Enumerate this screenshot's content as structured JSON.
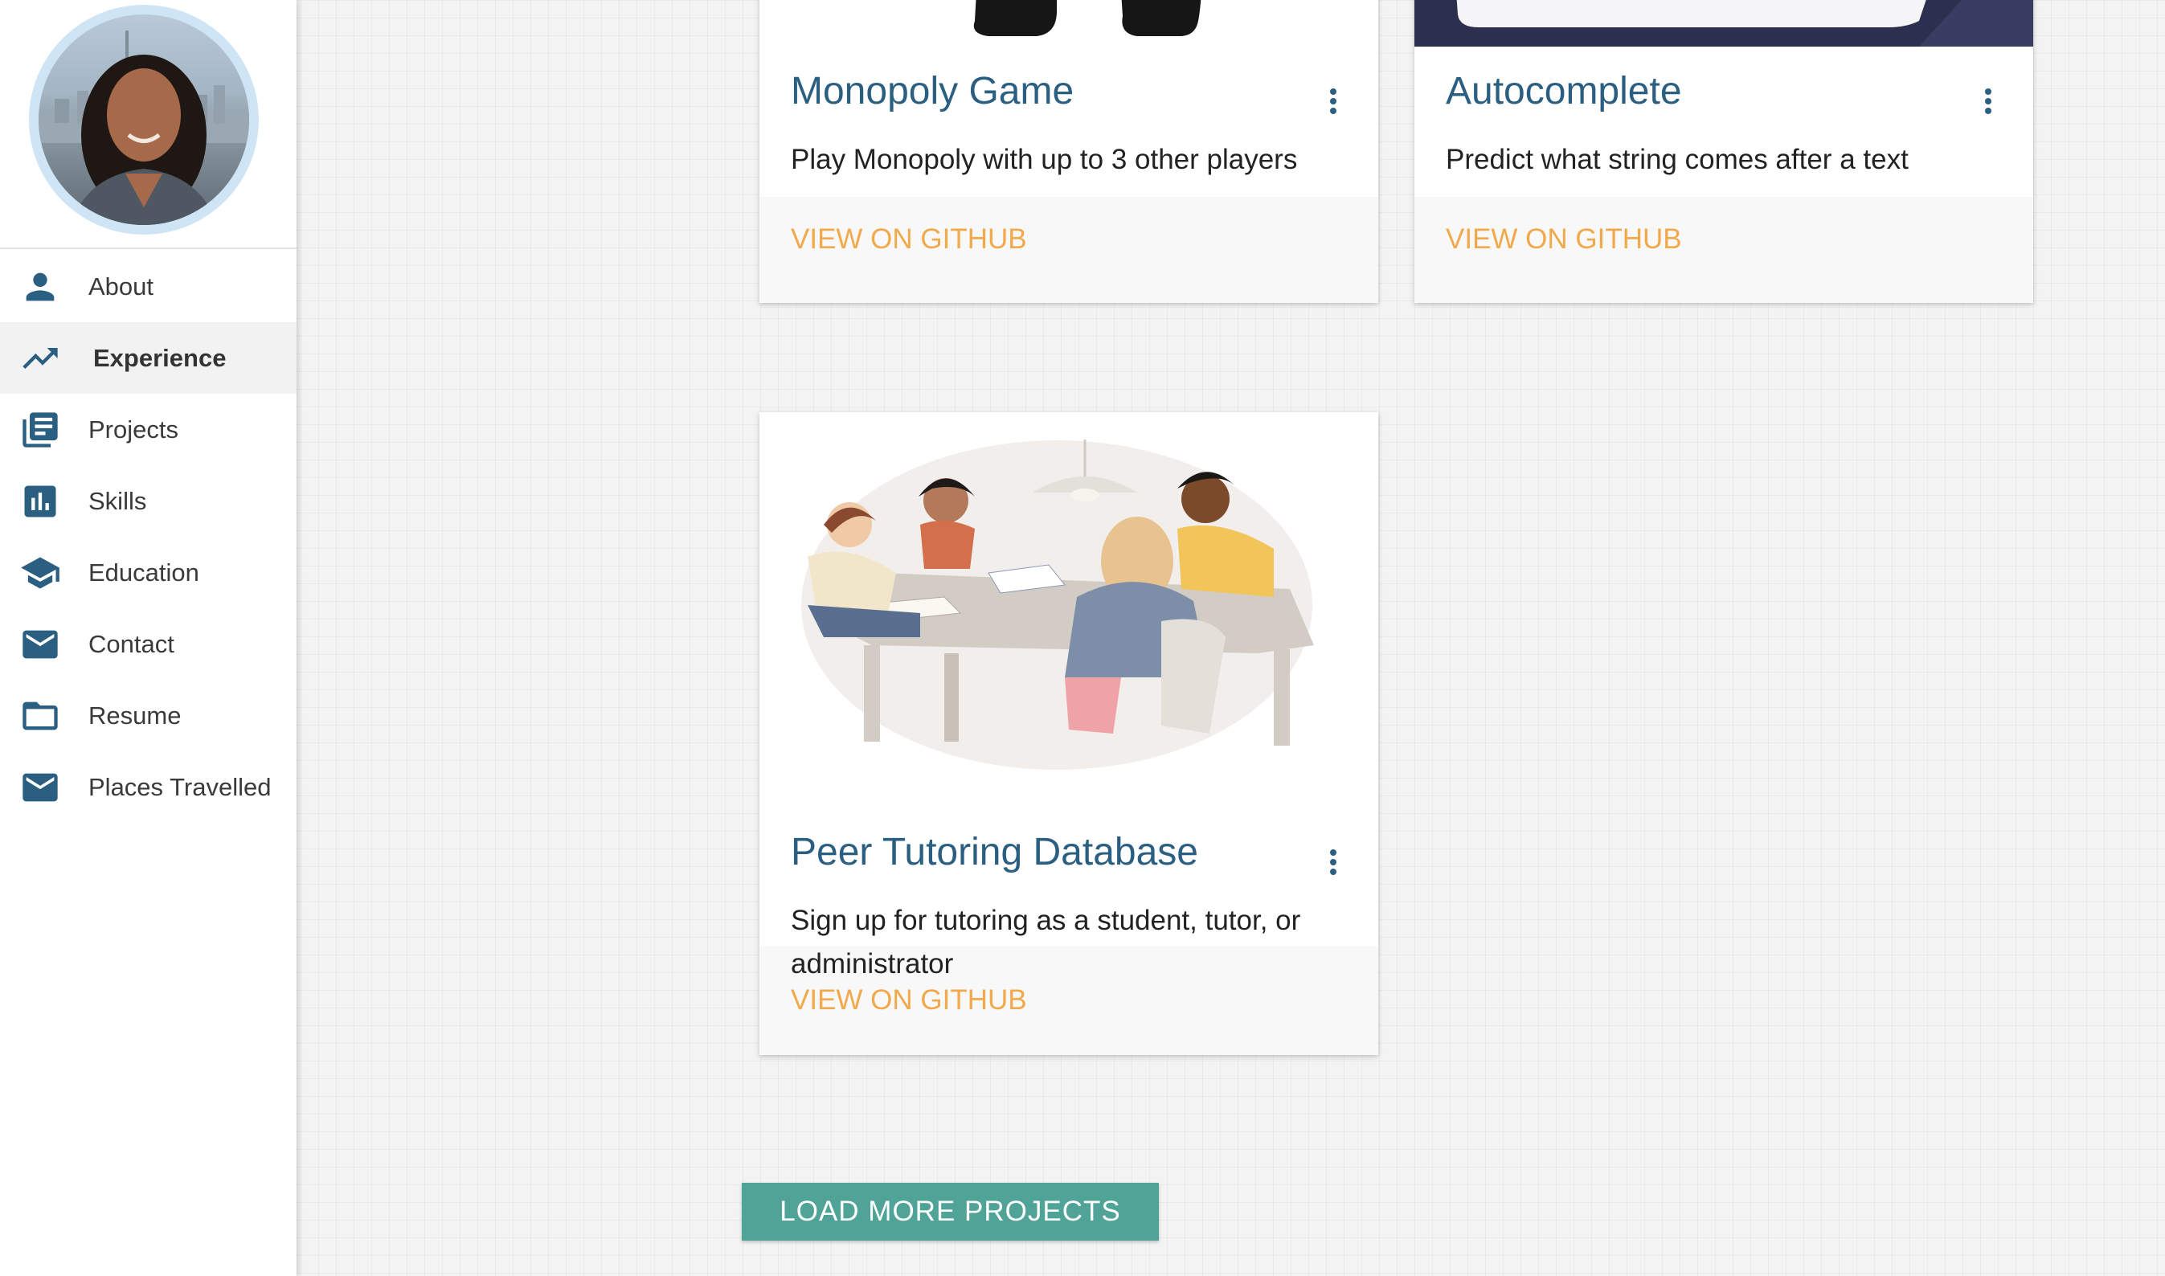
{
  "sidebar": {
    "items": [
      {
        "label": "About",
        "icon": "person-icon"
      },
      {
        "label": "Experience",
        "icon": "trending-up-icon",
        "active": true
      },
      {
        "label": "Projects",
        "icon": "library-books-icon"
      },
      {
        "label": "Skills",
        "icon": "bar-chart-icon"
      },
      {
        "label": "Education",
        "icon": "graduation-cap-icon"
      },
      {
        "label": "Contact",
        "icon": "mail-icon"
      },
      {
        "label": "Resume",
        "icon": "folder-icon"
      },
      {
        "label": "Places Travelled",
        "icon": "mail-icon"
      }
    ]
  },
  "projects": [
    {
      "title": "Monopoly Game",
      "description": "Play Monopoly with up to 3 other players",
      "link_label": "VIEW ON GITHUB"
    },
    {
      "title": "Autocomplete",
      "description": "Predict what string comes after a text",
      "link_label": "VIEW ON GITHUB"
    },
    {
      "title": "Peer Tutoring Database",
      "description": "Sign up for tutoring as a student, tutor, or administrator",
      "link_label": "VIEW ON GITHUB"
    }
  ],
  "load_more": {
    "label": "LOAD MORE PROJECTS"
  },
  "colors": {
    "title": "#2b5f82",
    "link": "#f1a94b",
    "button": "#4fa397",
    "icon": "#2b5f82"
  }
}
